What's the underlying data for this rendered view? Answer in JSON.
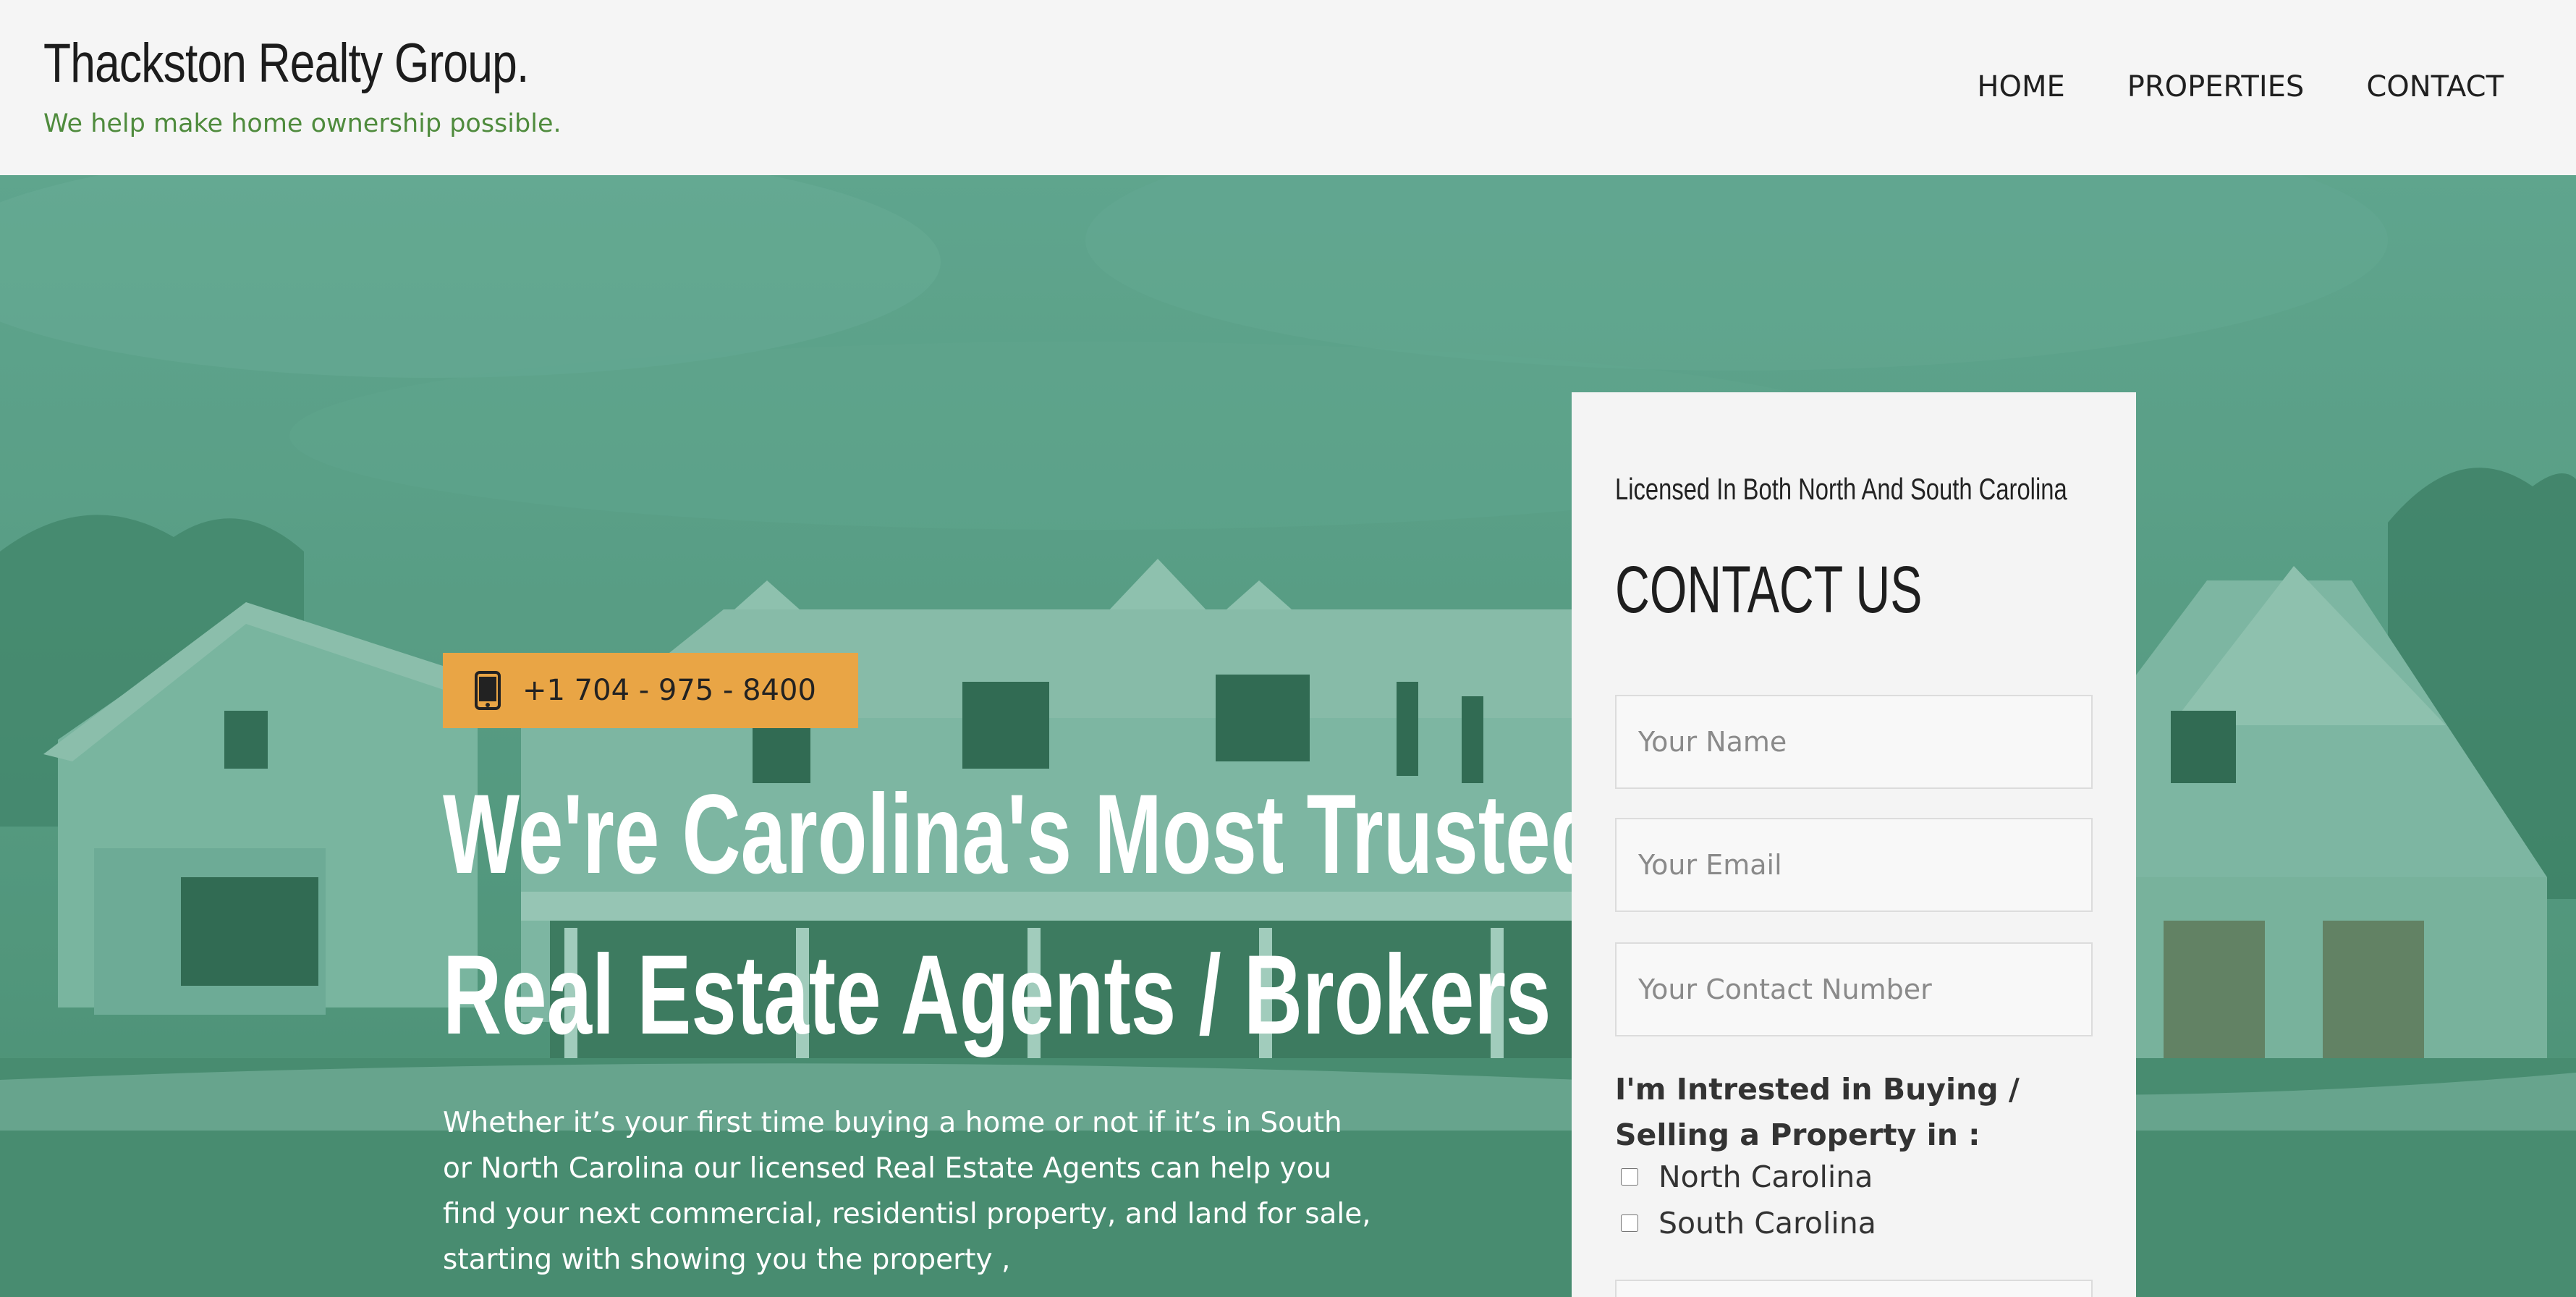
{
  "brand": {
    "title": "Thackston Realty Group.",
    "tagline": "We help make home ownership possible."
  },
  "nav": {
    "items": [
      "HOME",
      "PROPERTIES",
      "CONTACT"
    ]
  },
  "hero": {
    "phone_icon": "mobile-phone-icon",
    "phone": "+1 704 - 975 - 8400",
    "headline_line1": "We're Carolina's Most Trusted",
    "headline_line2": "Real Estate Agents / Brokers",
    "body": "Whether it’s your first time buying a home or not if it’s in South or North Carolina our licensed Real Estate Agents can help you find your next commercial, residentisl property, and land for sale, starting with showing you the property ,"
  },
  "contact_card": {
    "license": "Licensed In Both North And South Carolina",
    "title": "CONTACT US",
    "name_placeholder": "Your Name",
    "email_placeholder": "Your Email",
    "phone_placeholder": "Your Contact Number",
    "interest_label": "I'm Intrested in Buying / Selling a Property in :",
    "options": [
      "North Carolina",
      "South Carolina"
    ]
  },
  "colors": {
    "hero_overlay": "#5f9f87",
    "phone_badge": "#e9a545",
    "tagline": "#4f8b3d",
    "header_bg": "#f5f5f5"
  }
}
